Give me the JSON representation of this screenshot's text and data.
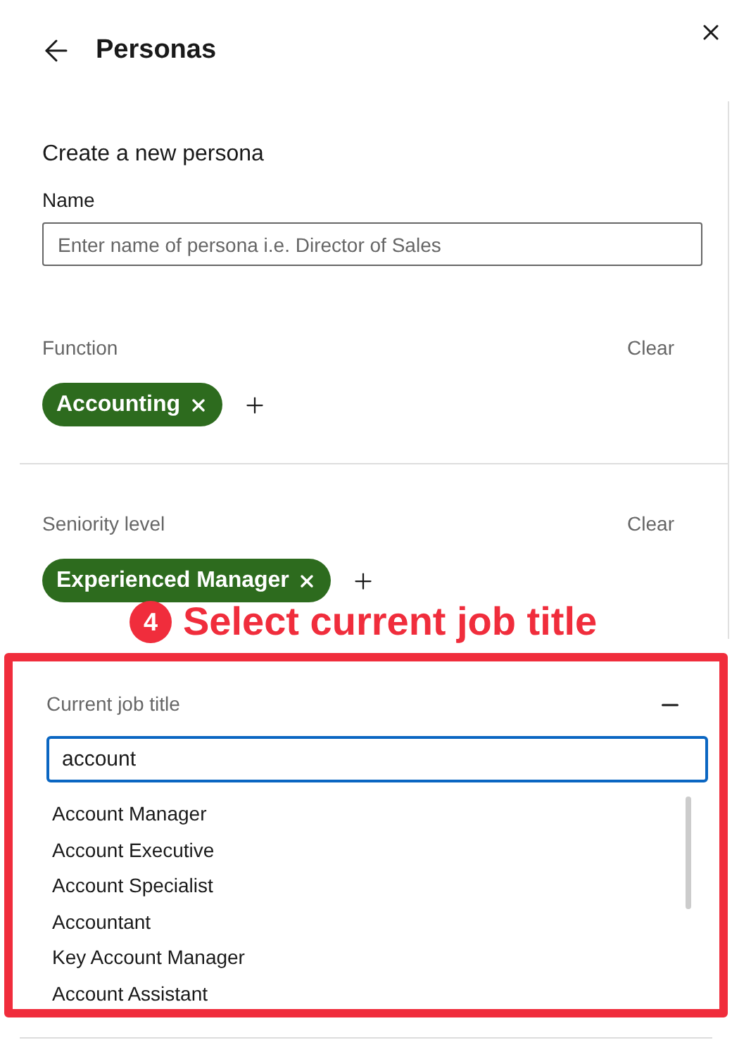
{
  "header": {
    "title": "Personas"
  },
  "form": {
    "heading": "Create a new persona",
    "name_label": "Name",
    "name_placeholder": "Enter name of persona i.e. Director of Sales"
  },
  "filters": [
    {
      "label": "Function",
      "clear": "Clear",
      "chips": [
        "Accounting"
      ]
    },
    {
      "label": "Seniority level",
      "clear": "Clear",
      "chips": [
        "Experienced Manager"
      ]
    }
  ],
  "annotation": {
    "step": "4",
    "text": "Select current job title"
  },
  "job_title": {
    "label": "Current job title",
    "expanded": true,
    "value": "account",
    "suggestions": [
      "Account Manager",
      "Account Executive",
      "Account Specialist",
      "Accountant",
      "Key Account Manager",
      "Account Assistant"
    ]
  }
}
